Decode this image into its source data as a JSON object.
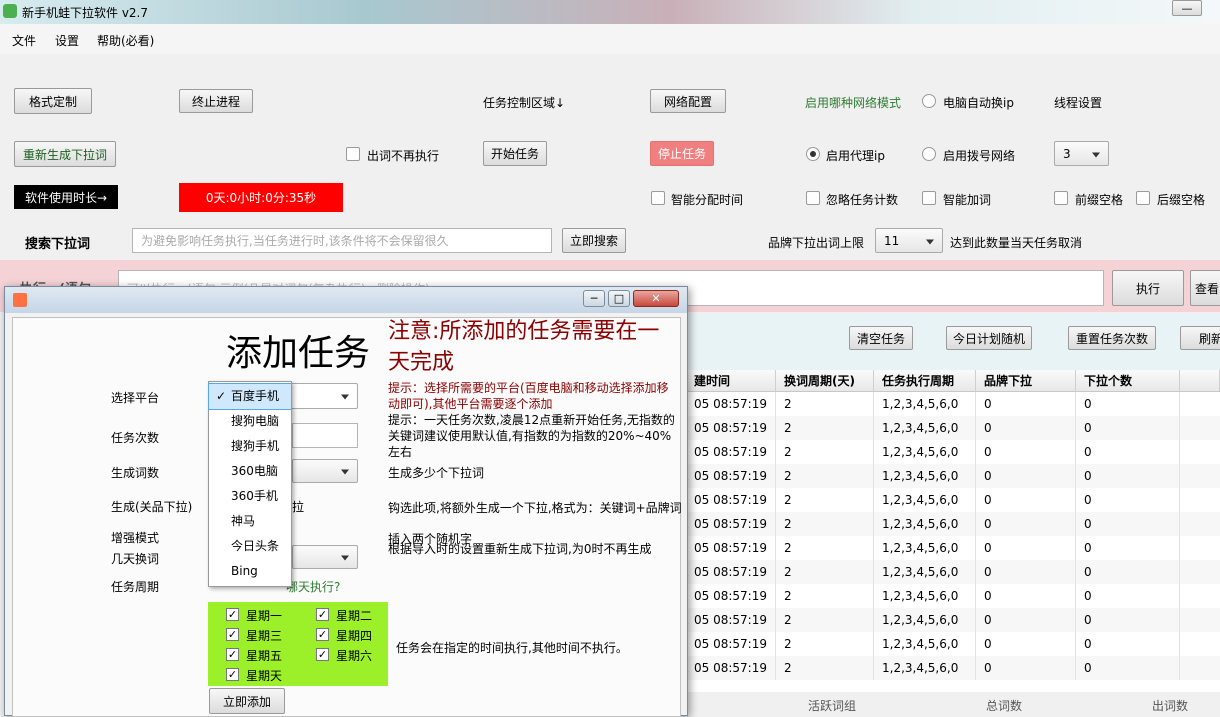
{
  "window": {
    "title": "新手机蛙下拉软件  v2.7"
  },
  "menu": [
    "文件",
    "设置",
    "帮助(必看)"
  ],
  "toolbar": {
    "format_button": "格式定制",
    "stop_process_button": "终止进程",
    "task_area_label": "任务控制区域↓",
    "network_button": "网络配置",
    "network_mode_label": "启用哪种网络模式",
    "auto_ip_label": "电脑自动换ip",
    "thread_label": "线程设置",
    "regen_button": "重新生成下拉词",
    "no_repeat_label": "出词不再执行",
    "start_task_button": "开始任务",
    "stop_task_button": "停止任务",
    "proxy_label": "启用代理ip",
    "dialup_label": "启用拨号网络",
    "thread_value": "3",
    "usage_label": "软件使用时长→",
    "usage_value": "0天:0小时:0分:35秒",
    "smart_time_label": "智能分配时间",
    "ignore_count_label": "忽略任务计数",
    "smart_add_label": "智能加词",
    "prefix_space_label": "前缀空格",
    "suffix_space_label": "后缀空格",
    "search_label": "搜索下拉词",
    "search_placeholder": "为避免影响任务执行,当任务进行时,该条件将不会保留很久",
    "search_button": "立即搜索",
    "brand_limit_label": "品牌下拉出词上限",
    "brand_limit_value": "11",
    "brand_limit_note": "达到此数量当天任务取消",
    "exec_partial": "执行一(语句",
    "exec_placeholder": "可以执行一(语句,示例(凡是对词句(复杂执行)...删除操作)...",
    "exec_button": "执行",
    "query_button": "查看"
  },
  "table_actions": {
    "clear": "清空任务",
    "random": "今日计划随机",
    "reset": "重置任务次数",
    "refresh": "刷新"
  },
  "table": {
    "headers": [
      "建时间",
      "换词周期(天)",
      "任务执行周期",
      "品牌下拉",
      "下拉个数"
    ],
    "rows": [
      [
        "05 08:57:19",
        "2",
        "1,2,3,4,5,6,0",
        "0",
        "0"
      ],
      [
        "05 08:57:19",
        "2",
        "1,2,3,4,5,6,0",
        "0",
        "0"
      ],
      [
        "05 08:57:19",
        "2",
        "1,2,3,4,5,6,0",
        "0",
        "0"
      ],
      [
        "05 08:57:19",
        "2",
        "1,2,3,4,5,6,0",
        "0",
        "0"
      ],
      [
        "05 08:57:19",
        "2",
        "1,2,3,4,5,6,0",
        "0",
        "0"
      ],
      [
        "05 08:57:19",
        "2",
        "1,2,3,4,5,6,0",
        "0",
        "0"
      ],
      [
        "05 08:57:19",
        "2",
        "1,2,3,4,5,6,0",
        "0",
        "0"
      ],
      [
        "05 08:57:19",
        "2",
        "1,2,3,4,5,6,0",
        "0",
        "0"
      ],
      [
        "05 08:57:19",
        "2",
        "1,2,3,4,5,6,0",
        "0",
        "0"
      ],
      [
        "05 08:57:19",
        "2",
        "1,2,3,4,5,6,0",
        "0",
        "0"
      ],
      [
        "05 08:57:19",
        "2",
        "1,2,3,4,5,6,0",
        "0",
        "0"
      ],
      [
        "05 08:57:19",
        "2",
        "1,2,3,4,5,6,0",
        "0",
        "0"
      ]
    ],
    "footer": [
      "活跃词组",
      "总词数",
      "出词数"
    ]
  },
  "dialog": {
    "title": "添加任务",
    "notice": "注意:所添加的任务需要在一天完成",
    "platform_label": "选择平台",
    "platform_hint": "提示：选择所需要的平台(百度电脑和移动选择添加移动即可),其他平台需要逐个添加",
    "count_label": "任务次数",
    "count_hint": "提示：一天任务次数,凌晨12点重新开始任务,无指数的关键词建议使用默认值,有指数的为指数的20%~40%左右",
    "gen_label": "生成词数",
    "gen_hint": "生成多少个下拉词",
    "brand_label": "生成(关品下拉)",
    "brand_partial": "拉",
    "brand_hint": "钩选此项,将额外生成一个下拉,格式为：关键词+品牌词",
    "enhance_label": "增强模式",
    "enhance_hint": "插入两个随机字",
    "days_label": "几天换词",
    "days_hint": "根据导入时的设置重新生成下拉词,为0时不再生成",
    "cycle_label": "任务周期",
    "cycle_question_partial": "哪天执行?",
    "weekdays": [
      "星期一",
      "星期二",
      "星期三",
      "星期四",
      "星期五",
      "星期六",
      "星期天"
    ],
    "cycle_hint": "任务会在指定的时间执行,其他时间不执行。",
    "add_button": "立即添加",
    "platform_options": [
      "百度手机",
      "搜狗电脑",
      "搜狗手机",
      "360电脑",
      "360手机",
      "神马",
      "今日头条",
      "Bing"
    ],
    "selected_platform": "百度手机"
  },
  "colors": {
    "accent_red": "#ff0000",
    "notice_red": "#8b0000",
    "weekday_green": "#9bf02a",
    "stop_button": "#f08080"
  }
}
